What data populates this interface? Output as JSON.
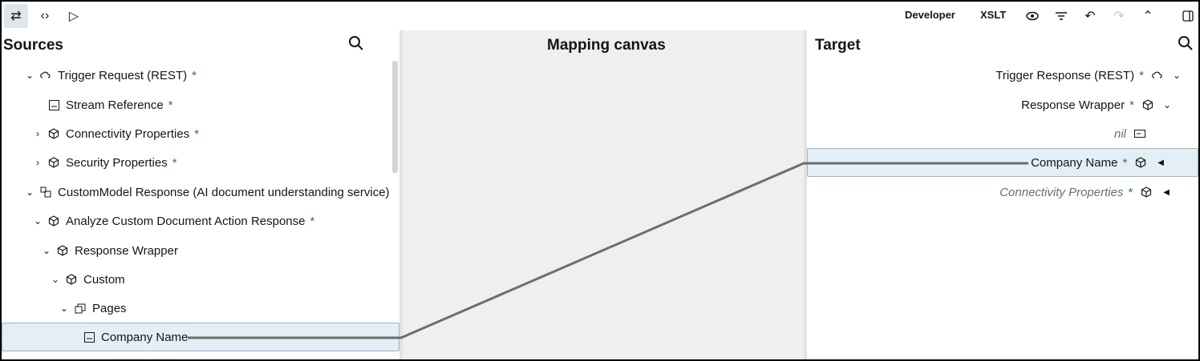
{
  "toolbar": {
    "left_icons": [
      "swap-icon",
      "code-icon",
      "play-icon"
    ],
    "developer_label": "Developer",
    "xslt_label": "XSLT",
    "right_icons": [
      "eye-icon",
      "filter-icon",
      "undo-icon",
      "redo-icon",
      "collapse-up-icon",
      "panel-toggle-icon"
    ]
  },
  "sources": {
    "title": "Sources",
    "rows": [
      {
        "label": "Trigger Request (REST)",
        "required": "*"
      },
      {
        "label": "Stream Reference",
        "required": "*"
      },
      {
        "label": "Connectivity Properties",
        "required": "*"
      },
      {
        "label": "Security Properties",
        "required": "*"
      },
      {
        "label": "CustomModel Response (AI document understanding service)",
        "required": ""
      },
      {
        "label": "Analyze Custom Document Action Response",
        "required": "*"
      },
      {
        "label": "Response Wrapper",
        "required": ""
      },
      {
        "label": "Custom",
        "required": ""
      },
      {
        "label": "Pages",
        "required": ""
      },
      {
        "label": "Company Name",
        "required": ""
      }
    ]
  },
  "canvas": {
    "title": "Mapping canvas"
  },
  "target": {
    "title": "Target",
    "rows": [
      {
        "label": "Trigger Response (REST)",
        "required": "*"
      },
      {
        "label": "Response Wrapper",
        "required": "*"
      },
      {
        "label": "nil",
        "required": ""
      },
      {
        "label": "Company Name",
        "required": "*"
      },
      {
        "label": "Connectivity Properties",
        "required": "*"
      }
    ]
  },
  "colors": {
    "selection": "#e3eef5",
    "mapping_line": "#6b6e6c",
    "canvas": "#f1efed"
  }
}
